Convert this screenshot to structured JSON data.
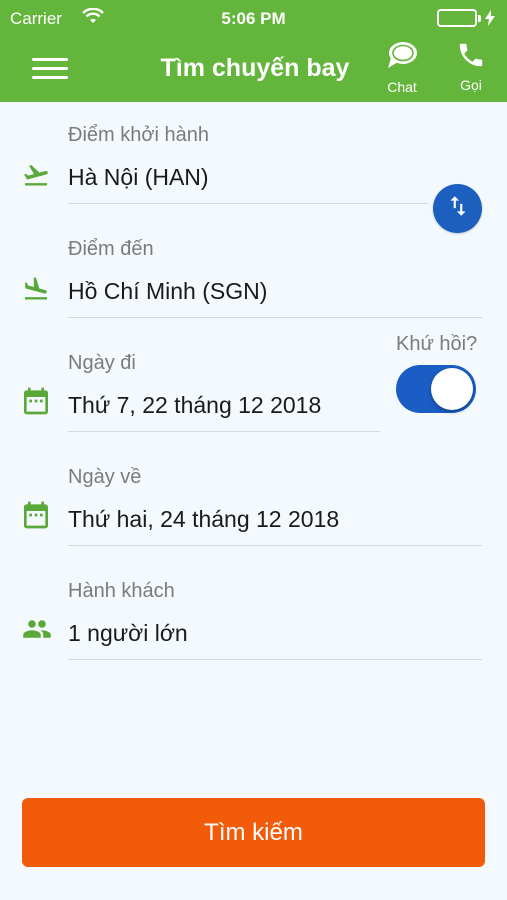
{
  "status_bar": {
    "carrier": "Carrier",
    "time": "5:06 PM"
  },
  "nav": {
    "title": "Tìm chuyến bay",
    "chat_label": "Chat",
    "call_label": "Gọi"
  },
  "form": {
    "origin": {
      "label": "Điểm khởi hành",
      "value": "Hà Nội (HAN)"
    },
    "destination": {
      "label": "Điểm đến",
      "value": "Hồ Chí Minh (SGN)"
    },
    "depart_date": {
      "label": "Ngày đi",
      "value": "Thứ 7, 22 tháng 12 2018"
    },
    "roundtrip": {
      "label": "Khứ hồi?",
      "enabled": true
    },
    "return_date": {
      "label": "Ngày về",
      "value": "Thứ hai, 24 tháng 12 2018"
    },
    "passengers": {
      "label": "Hành khách",
      "value": "1 người lớn"
    }
  },
  "search_button": "Tìm kiếm",
  "colors": {
    "header": "#64b53c",
    "icon_green": "#5aa83a",
    "accent_blue": "#1c5fbf",
    "search_orange": "#f25b0a"
  },
  "icons": {
    "menu": "hamburger-menu-icon",
    "chat": "chat-bubble-icon",
    "call": "phone-icon",
    "origin": "flight-takeoff-icon",
    "destination": "flight-land-icon",
    "date": "calendar-icon",
    "passengers": "people-icon",
    "swap": "swap-vertical-icon"
  }
}
